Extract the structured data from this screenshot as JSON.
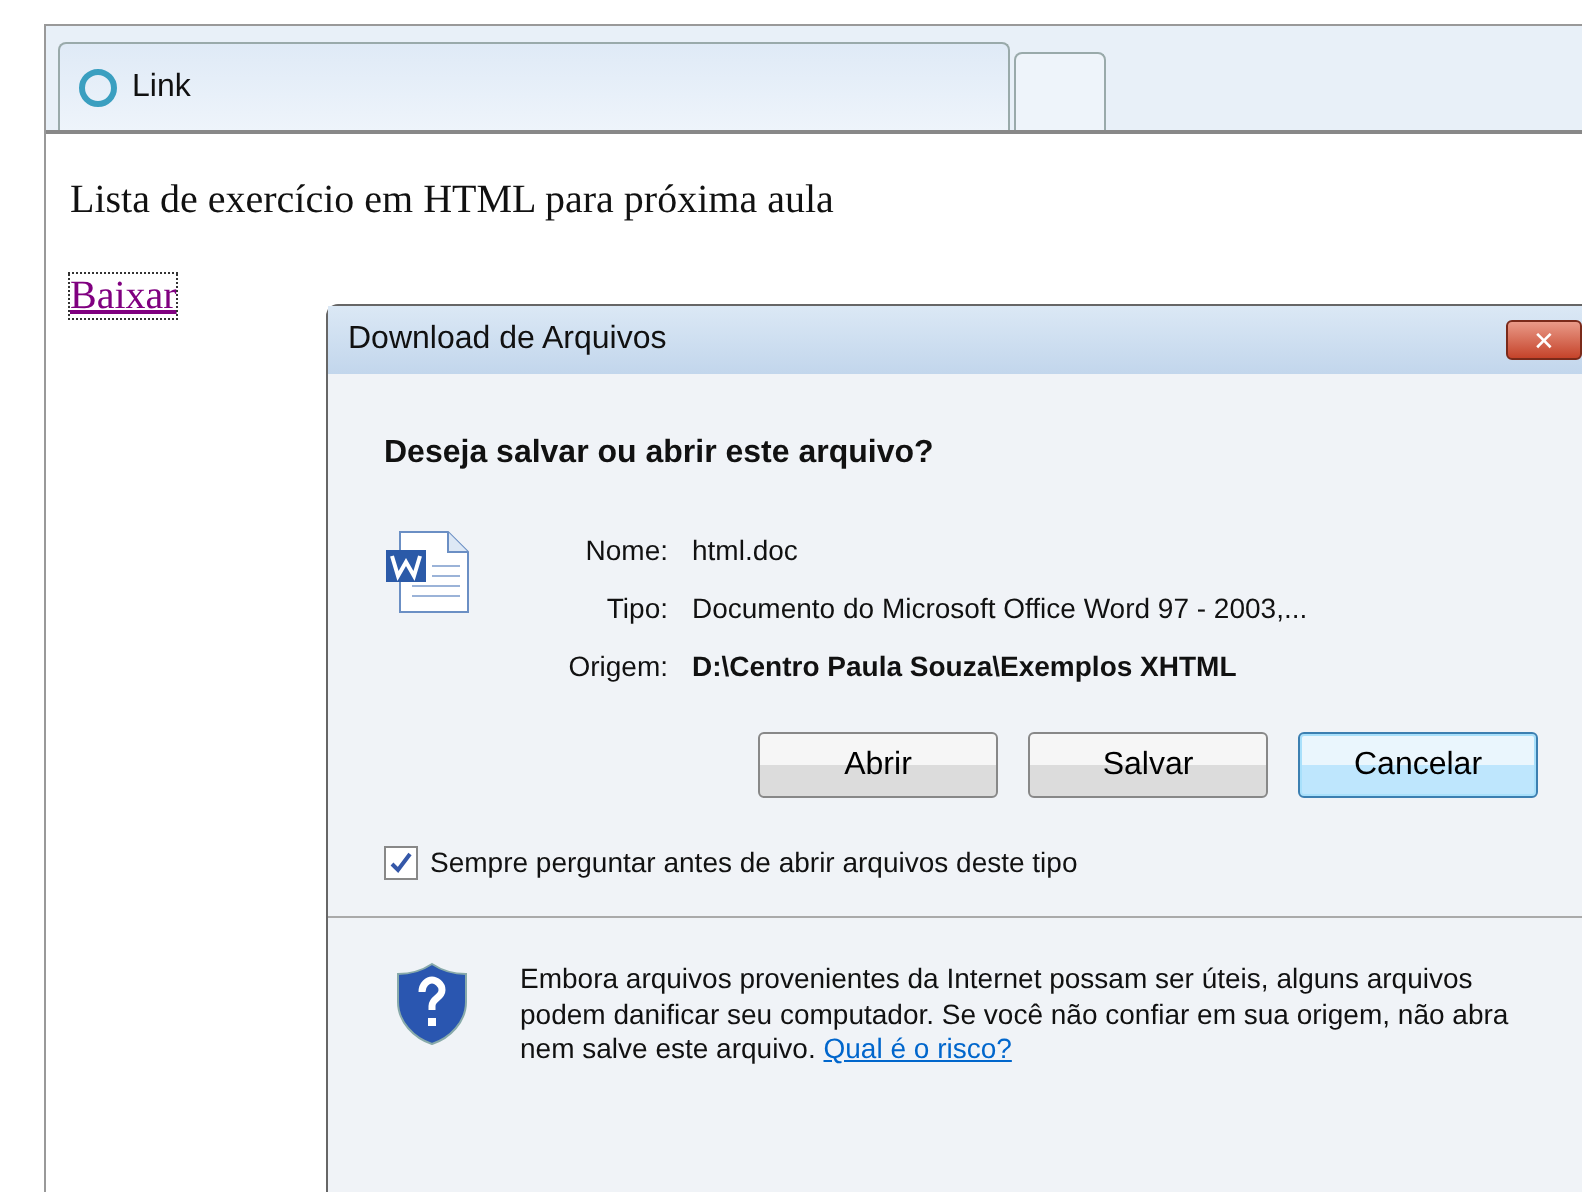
{
  "browser": {
    "tabs": [
      {
        "label": "Link",
        "selected": true
      }
    ]
  },
  "page": {
    "heading": "Lista de exercício em HTML para próxima aula",
    "link": "Baixar"
  },
  "dialog": {
    "title": "Download de Arquivos",
    "close": "✕",
    "question": "Deseja salvar ou abrir este arquivo?",
    "fields": [
      {
        "label": "Nome:",
        "value": "html.doc",
        "bold": false
      },
      {
        "label": "Tipo:",
        "value": "Documento do Microsoft Office Word 97 - 2003,...",
        "bold": false
      },
      {
        "label": "Origem:",
        "value": "D:\\Centro Paula Souza\\Exemplos XHTML",
        "bold": true
      }
    ],
    "buttons": [
      {
        "label": "Abrir",
        "default": false
      },
      {
        "label": "Salvar",
        "default": false
      },
      {
        "label": "Cancelar",
        "default": true
      }
    ],
    "checkbox": {
      "label": "Sempre perguntar antes de abrir arquivos deste tipo",
      "checked": true
    },
    "warning": {
      "text": "Embora arquivos provenientes da Internet possam ser úteis, alguns arquivos podem danificar seu computador. Se você não confiar em sua origem, não abra nem salve este arquivo.",
      "link": "Qual é o risco?"
    }
  }
}
